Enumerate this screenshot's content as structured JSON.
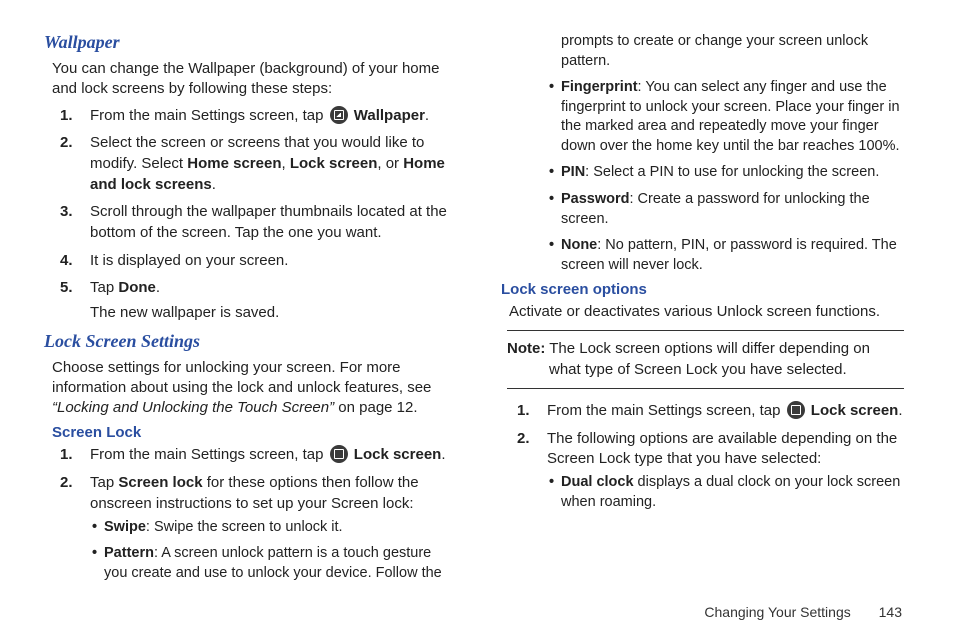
{
  "wallpaper": {
    "heading": "Wallpaper",
    "intro": "You can change the Wallpaper (background) of your home and lock screens by following these steps:",
    "steps": [
      {
        "n": "1.",
        "pre": "From the main Settings screen, tap ",
        "bold": "Wallpaper",
        "post": "."
      },
      {
        "n": "2.",
        "pre": "Select the screen or screens that you would like to modify. Select ",
        "b1": "Home screen",
        "m1": ", ",
        "b2": "Lock screen",
        "m2": ", or ",
        "b3": "Home and lock screens",
        "post": "."
      },
      {
        "n": "3.",
        "text": "Scroll through the wallpaper thumbnails located at the bottom of the screen. Tap the one you want."
      },
      {
        "n": "4.",
        "text": "It is displayed on your screen."
      },
      {
        "n": "5.",
        "pre": "Tap ",
        "bold": "Done",
        "post": ".",
        "sub": "The new wallpaper is saved."
      }
    ]
  },
  "lockscreen": {
    "heading": "Lock Screen Settings",
    "intro_a": "Choose settings for unlocking your screen. For more information about using the lock and unlock features, see ",
    "intro_em": "“Locking and Unlocking the Touch Screen”",
    "intro_b": " on page 12.",
    "h3": "Screen Lock",
    "step1_pre": "From the main Settings screen, tap ",
    "step1_bold": "Lock screen",
    "step1_post": ".",
    "step2_pre": "Tap ",
    "step2_bold": "Screen lock",
    "step2_post": " for these options then follow the onscreen instructions to set up your Screen lock:",
    "opts": [
      {
        "b": "Swipe",
        "t": ": Swipe the screen to unlock it."
      },
      {
        "b": "Pattern",
        "t": ": A screen unlock pattern is a touch gesture you create and use to unlock your device. Follow the prompts to create or change your screen unlock pattern."
      },
      {
        "b": "Fingerprint",
        "t": ": You can select any finger and use the fingerprint to unlock your screen. Place your finger in the marked area and repeatedly move your finger down over the home key until the bar reaches 100%."
      },
      {
        "b": "PIN",
        "t": ": Select a PIN to use for unlocking the screen."
      },
      {
        "b": "Password",
        "t": ": Create a password for unlocking the screen."
      },
      {
        "b": "None",
        "t": ": No pattern, PIN, or password is required. The screen will never lock."
      }
    ]
  },
  "lso": {
    "heading": "Lock screen options",
    "intro": "Activate or deactivates various Unlock screen functions.",
    "note_b": "Note:",
    "note_t": " The Lock screen options will differ depending on what type of Screen Lock you have selected.",
    "step1_pre": "From the main Settings screen, tap ",
    "step1_bold": "Lock screen",
    "step1_post": ".",
    "step2": "The following options are available depending on the Screen Lock type that you have selected:",
    "sub_b": "Dual clock",
    "sub_t": " displays a dual clock on your lock screen when roaming."
  },
  "footer": {
    "chapter": "Changing Your Settings",
    "page": "143"
  }
}
